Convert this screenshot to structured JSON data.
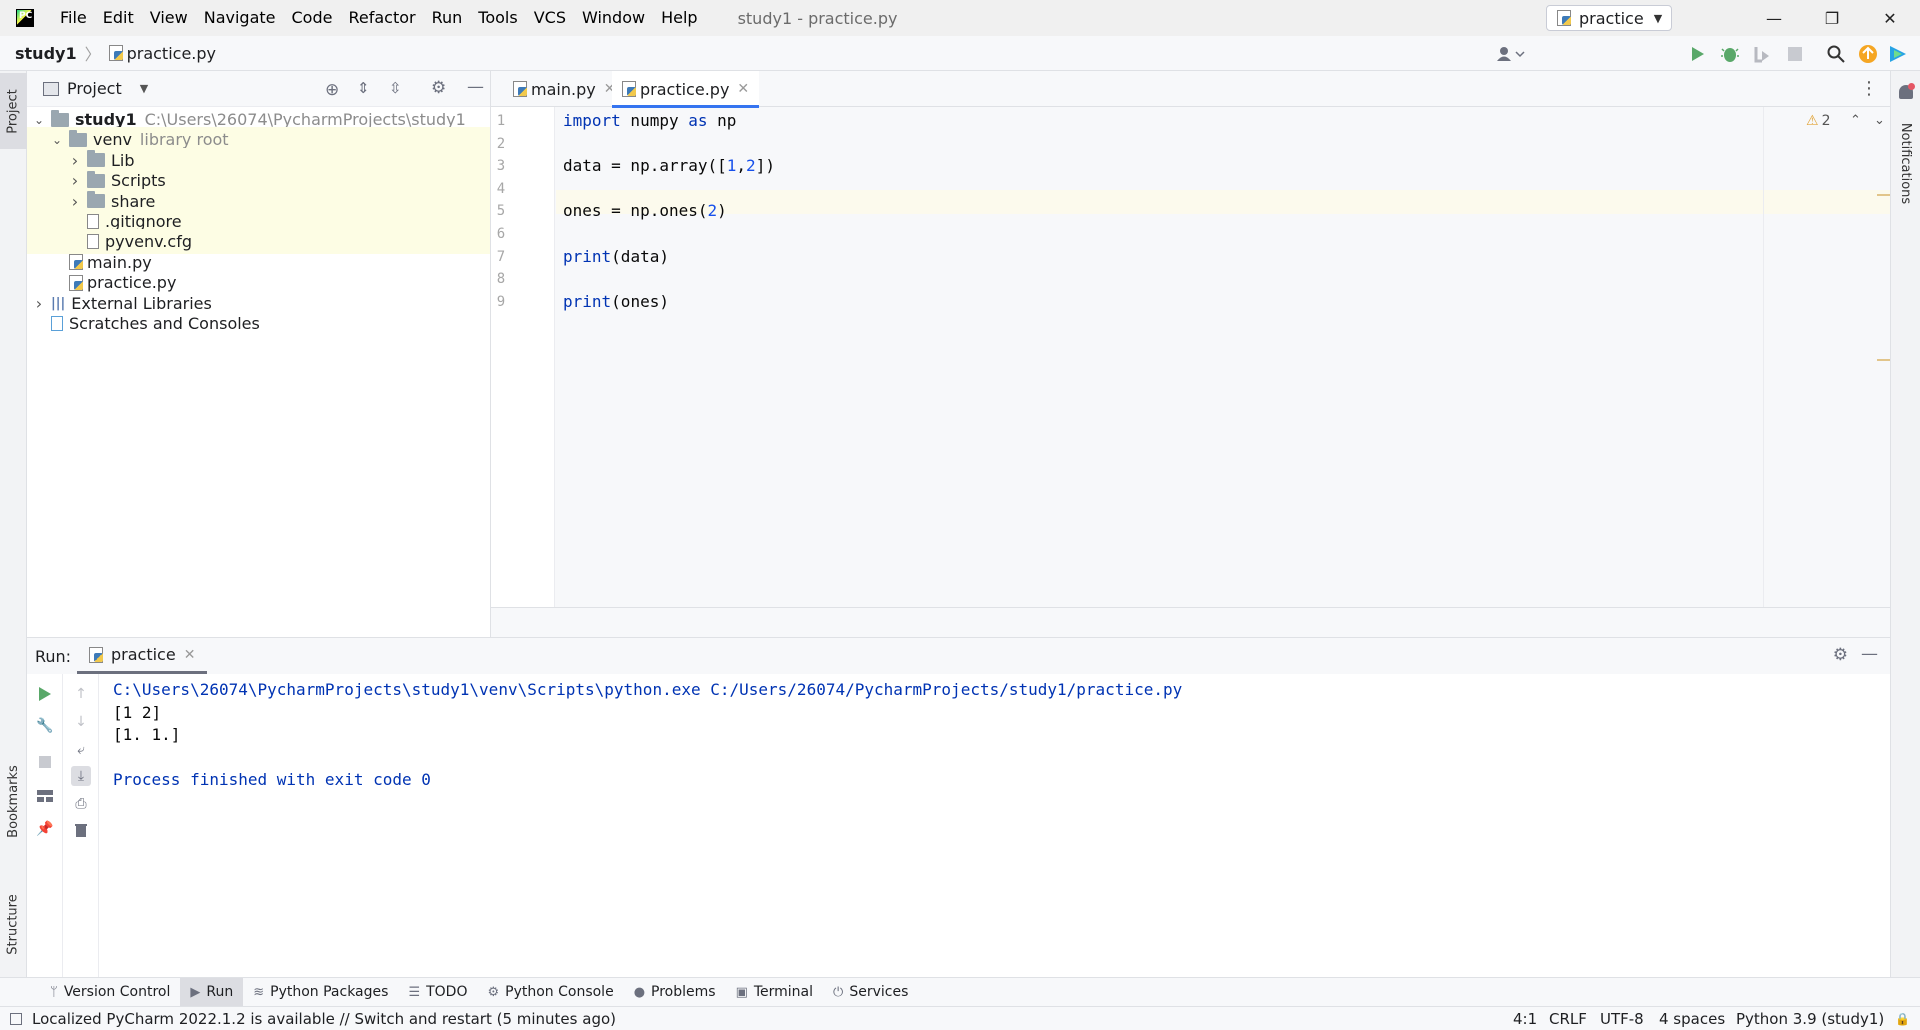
{
  "menu": [
    "File",
    "Edit",
    "View",
    "Navigate",
    "Code",
    "Refactor",
    "Run",
    "Tools",
    "VCS",
    "Window",
    "Help"
  ],
  "window_title": "study1 - practice.py",
  "window_controls": {
    "minimize": "—",
    "restore": "❐",
    "close": "✕"
  },
  "breadcrumb": {
    "project": "study1",
    "file": "practice.py"
  },
  "toolbar": {
    "run_config": "practice"
  },
  "project_panel": {
    "title": "Project",
    "tree": [
      {
        "label": "study1",
        "hint": "C:\\Users\\26074\\PycharmProjects\\study1",
        "type": "folder",
        "depth": 0,
        "expanded": true
      },
      {
        "label": "venv",
        "hint": "library root",
        "type": "folder",
        "depth": 1,
        "expanded": true
      },
      {
        "label": "Lib",
        "hint": "",
        "type": "folder",
        "depth": 2,
        "expanded": false
      },
      {
        "label": "Scripts",
        "hint": "",
        "type": "folder",
        "depth": 2,
        "expanded": false
      },
      {
        "label": "share",
        "hint": "",
        "type": "folder",
        "depth": 2,
        "expanded": false
      },
      {
        "label": ".gitignore",
        "hint": "",
        "type": "file",
        "depth": 2
      },
      {
        "label": "pyvenv.cfg",
        "hint": "",
        "type": "file",
        "depth": 2
      },
      {
        "label": "main.py",
        "hint": "",
        "type": "pyfile",
        "depth": 1
      },
      {
        "label": "practice.py",
        "hint": "",
        "type": "pyfile",
        "depth": 1
      },
      {
        "label": "External Libraries",
        "hint": "",
        "type": "libs",
        "depth": 0,
        "expanded": false
      },
      {
        "label": "Scratches and Consoles",
        "hint": "",
        "type": "scratch",
        "depth": 0
      }
    ]
  },
  "editor": {
    "tabs": [
      {
        "label": "main.py",
        "active": false
      },
      {
        "label": "practice.py",
        "active": true
      }
    ],
    "warnings": "2",
    "lines": [
      {
        "no": "1",
        "code": "import numpy as np"
      },
      {
        "no": "2",
        "code": ""
      },
      {
        "no": "3",
        "code": "data = np.array([1,2])"
      },
      {
        "no": "4",
        "code": ""
      },
      {
        "no": "5",
        "code": "ones = np.ones(2)"
      },
      {
        "no": "6",
        "code": ""
      },
      {
        "no": "7",
        "code": "print(data)"
      },
      {
        "no": "8",
        "code": ""
      },
      {
        "no": "9",
        "code": "print(ones)"
      }
    ]
  },
  "run_panel": {
    "label": "Run:",
    "tab": "practice",
    "output": [
      {
        "text": "C:\\Users\\26074\\PycharmProjects\\study1\\venv\\Scripts\\python.exe C:/Users/26074/PycharmProjects/study1/practice.py",
        "kind": "cmd"
      },
      {
        "text": "[1 2]",
        "kind": "out"
      },
      {
        "text": "[1. 1.]",
        "kind": "out"
      },
      {
        "text": "",
        "kind": "out"
      },
      {
        "text": "Process finished with exit code 0",
        "kind": "cmd"
      }
    ]
  },
  "left_strip": {
    "project": "Project",
    "bookmarks": "Bookmarks",
    "structure": "Structure"
  },
  "right_strip": {
    "notifications": "Notifications"
  },
  "bottom_tools": [
    {
      "label": "Version Control",
      "icon": "branch-icon",
      "active": false
    },
    {
      "label": "Run",
      "icon": "run-icon",
      "active": true
    },
    {
      "label": "Python Packages",
      "icon": "packages-icon",
      "active": false
    },
    {
      "label": "TODO",
      "icon": "todo-icon",
      "active": false
    },
    {
      "label": "Python Console",
      "icon": "console-icon",
      "active": false
    },
    {
      "label": "Problems",
      "icon": "problems-icon",
      "active": false
    },
    {
      "label": "Terminal",
      "icon": "terminal-icon",
      "active": false
    },
    {
      "label": "Services",
      "icon": "services-icon",
      "active": false
    }
  ],
  "status": {
    "message": "Localized PyCharm 2022.1.2 is available // Switch and restart (5 minutes ago)",
    "position": "4:1",
    "line_sep": "CRLF",
    "encoding": "UTF-8",
    "indent": "4 spaces",
    "interpreter": "Python 3.9 (study1)"
  },
  "colors": {
    "accent": "#3574f0",
    "keyword": "#0033b3",
    "number": "#1750eb",
    "console_cmd": "#0033b3",
    "run_green": "#59a869",
    "highlight_row": "#fdfde4"
  }
}
